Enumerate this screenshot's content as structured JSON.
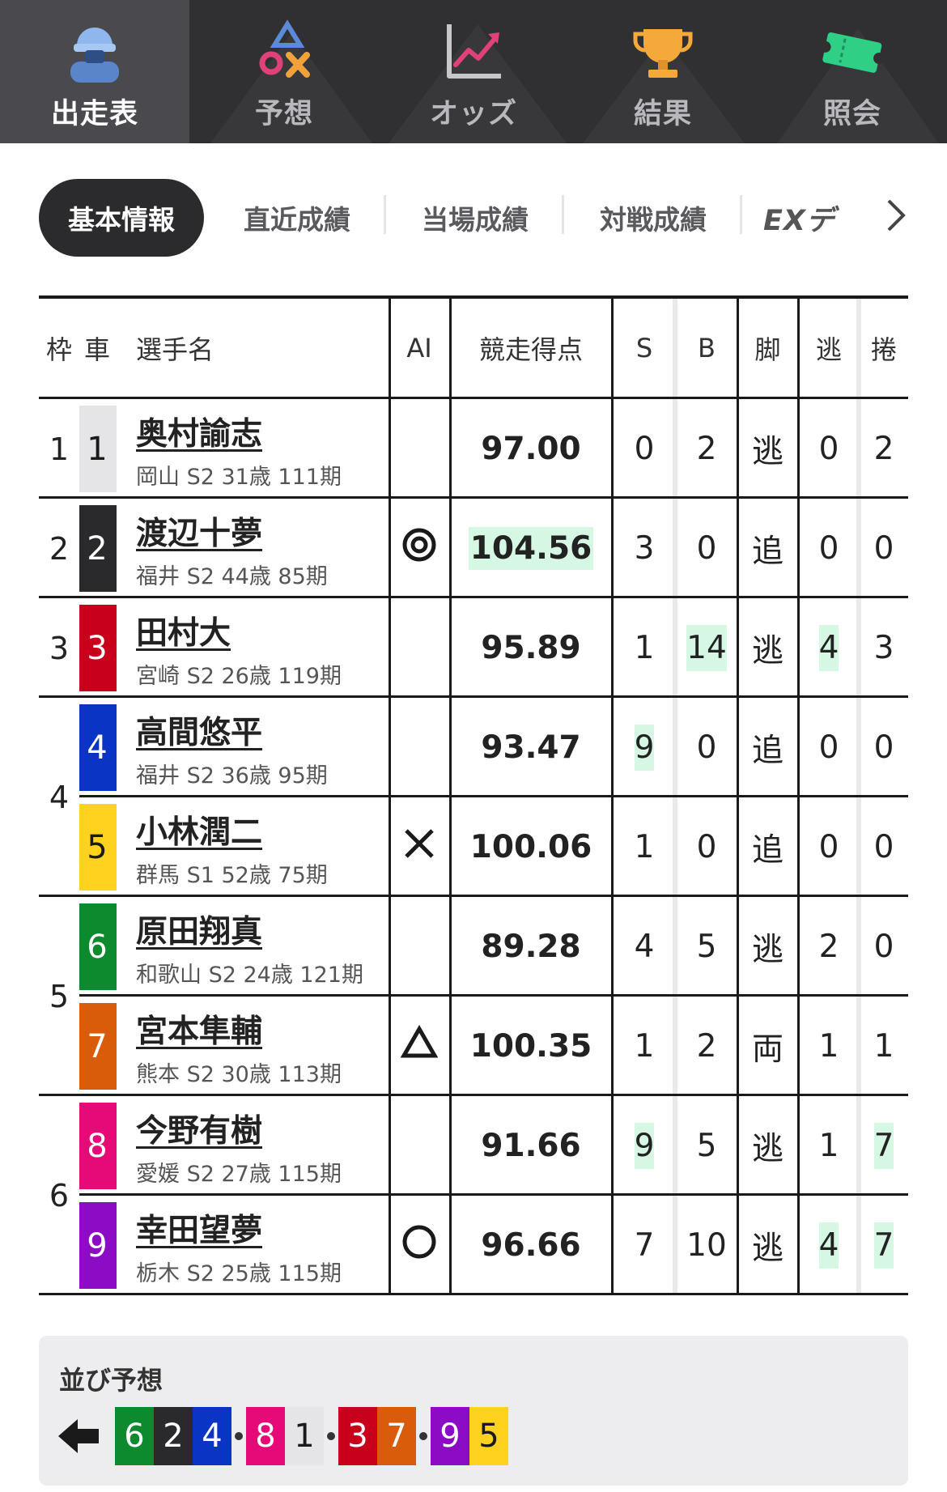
{
  "nav": [
    {
      "label": "出走表",
      "icon": "player-icon",
      "active": true
    },
    {
      "label": "予想",
      "icon": "prediction-icon",
      "active": false
    },
    {
      "label": "オッズ",
      "icon": "odds-chart-icon",
      "active": false
    },
    {
      "label": "結果",
      "icon": "trophy-icon",
      "active": false
    },
    {
      "label": "照会",
      "icon": "ticket-icon",
      "active": false
    }
  ],
  "subtabs": {
    "active": "基本情報",
    "items": [
      "直近成績",
      "当場成績",
      "対戦成績"
    ],
    "ex_label": "EXデ"
  },
  "table": {
    "headers": {
      "waku": "枠",
      "car": "車",
      "name": "選手名",
      "ai": "AI",
      "score": "競走得点",
      "s": "S",
      "b": "B",
      "leg": "脚",
      "nige": "逃",
      "makuri": "捲"
    },
    "waku_groups": [
      "1",
      "2",
      "3",
      "4",
      "5",
      "6"
    ],
    "rows": [
      {
        "car": "1",
        "name": "奥村諭志",
        "info": "岡山 S2 31歳 111期",
        "ai": "",
        "score": "97.00",
        "s": "0",
        "b": "2",
        "leg": "逃",
        "nige": "0",
        "makuri": "2"
      },
      {
        "car": "2",
        "name": "渡辺十夢",
        "info": "福井 S2 44歳 85期",
        "ai": "◎",
        "score": "104.56",
        "s": "3",
        "b": "0",
        "leg": "追",
        "nige": "0",
        "makuri": "0"
      },
      {
        "car": "3",
        "name": "田村大",
        "info": "宮崎 S2 26歳 119期",
        "ai": "",
        "score": "95.89",
        "s": "1",
        "b": "14",
        "leg": "逃",
        "nige": "4",
        "makuri": "3"
      },
      {
        "car": "4",
        "name": "高間悠平",
        "info": "福井 S2 36歳 95期",
        "ai": "",
        "score": "93.47",
        "s": "9",
        "b": "0",
        "leg": "追",
        "nige": "0",
        "makuri": "0"
      },
      {
        "car": "5",
        "name": "小林潤二",
        "info": "群馬 S1 52歳 75期",
        "ai": "×",
        "score": "100.06",
        "s": "1",
        "b": "0",
        "leg": "追",
        "nige": "0",
        "makuri": "0"
      },
      {
        "car": "6",
        "name": "原田翔真",
        "info": "和歌山 S2 24歳 121期",
        "ai": "",
        "score": "89.28",
        "s": "4",
        "b": "5",
        "leg": "逃",
        "nige": "2",
        "makuri": "0"
      },
      {
        "car": "7",
        "name": "宮本隼輔",
        "info": "熊本 S2 30歳 113期",
        "ai": "△",
        "score": "100.35",
        "s": "1",
        "b": "2",
        "leg": "両",
        "nige": "1",
        "makuri": "1"
      },
      {
        "car": "8",
        "name": "今野有樹",
        "info": "愛媛 S2 27歳 115期",
        "ai": "",
        "score": "91.66",
        "s": "9",
        "b": "5",
        "leg": "逃",
        "nige": "1",
        "makuri": "7"
      },
      {
        "car": "9",
        "name": "幸田望夢",
        "info": "栃木 S2 25歳 115期",
        "ai": "○",
        "score": "96.66",
        "s": "7",
        "b": "10",
        "leg": "逃",
        "nige": "4",
        "makuri": "7"
      }
    ]
  },
  "narabi": {
    "title": "並び予想",
    "sequence": [
      "6",
      "2",
      "4",
      "·",
      "8",
      "1",
      "·",
      "3",
      "7",
      "·",
      "9",
      "5"
    ]
  },
  "colors": {
    "car1": "#e5e5e7",
    "car2": "#2a2a2c",
    "car3": "#c9001c",
    "car4": "#0a35c4",
    "car5": "#ffd21f",
    "car6": "#0d8a2e",
    "car7": "#d85c0a",
    "car8": "#e60a78",
    "car9": "#8c0bc4",
    "highlight": "#d5f7e4"
  }
}
